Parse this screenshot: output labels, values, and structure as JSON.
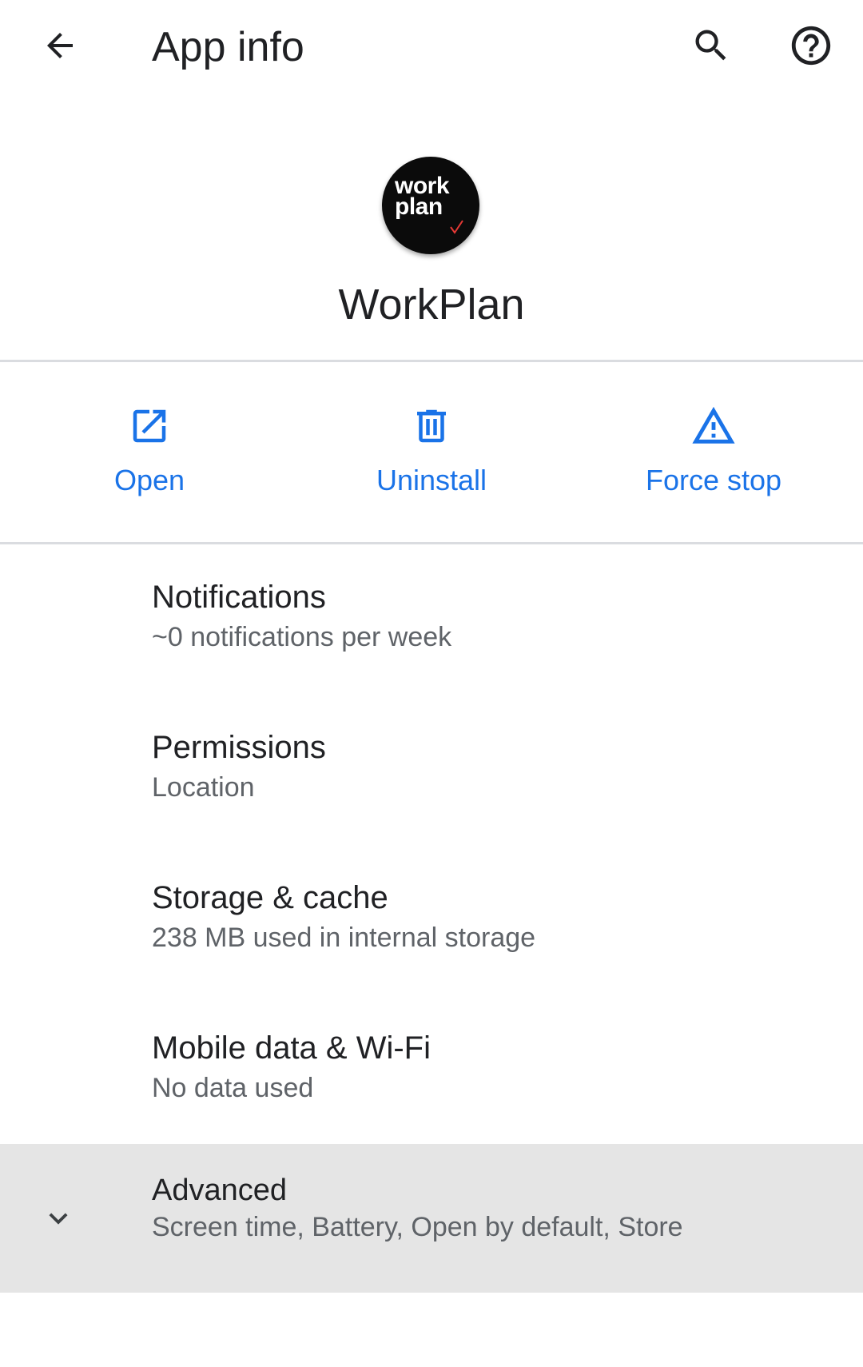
{
  "header": {
    "title": "App info"
  },
  "app": {
    "icon_line1": "work",
    "icon_line2": "plan",
    "name": "WorkPlan"
  },
  "actions": [
    {
      "label": "Open",
      "icon": "open-in-new-icon"
    },
    {
      "label": "Uninstall",
      "icon": "trash-icon"
    },
    {
      "label": "Force stop",
      "icon": "warning-icon"
    }
  ],
  "settings": [
    {
      "title": "Notifications",
      "summary": "~0 notifications per week"
    },
    {
      "title": "Permissions",
      "summary": "Location"
    },
    {
      "title": "Storage & cache",
      "summary": "238 MB used in internal storage"
    },
    {
      "title": "Mobile data & Wi-Fi",
      "summary": "No data used"
    },
    {
      "title": "Advanced",
      "summary": "Screen time, Battery, Open by default, Store"
    }
  ],
  "colors": {
    "accent": "#1a73e8",
    "text_primary": "#202124",
    "text_secondary": "#5f6368",
    "divider": "#dadce0",
    "advanced_bg": "#e5e5e5",
    "icon_check": "#e53935"
  }
}
